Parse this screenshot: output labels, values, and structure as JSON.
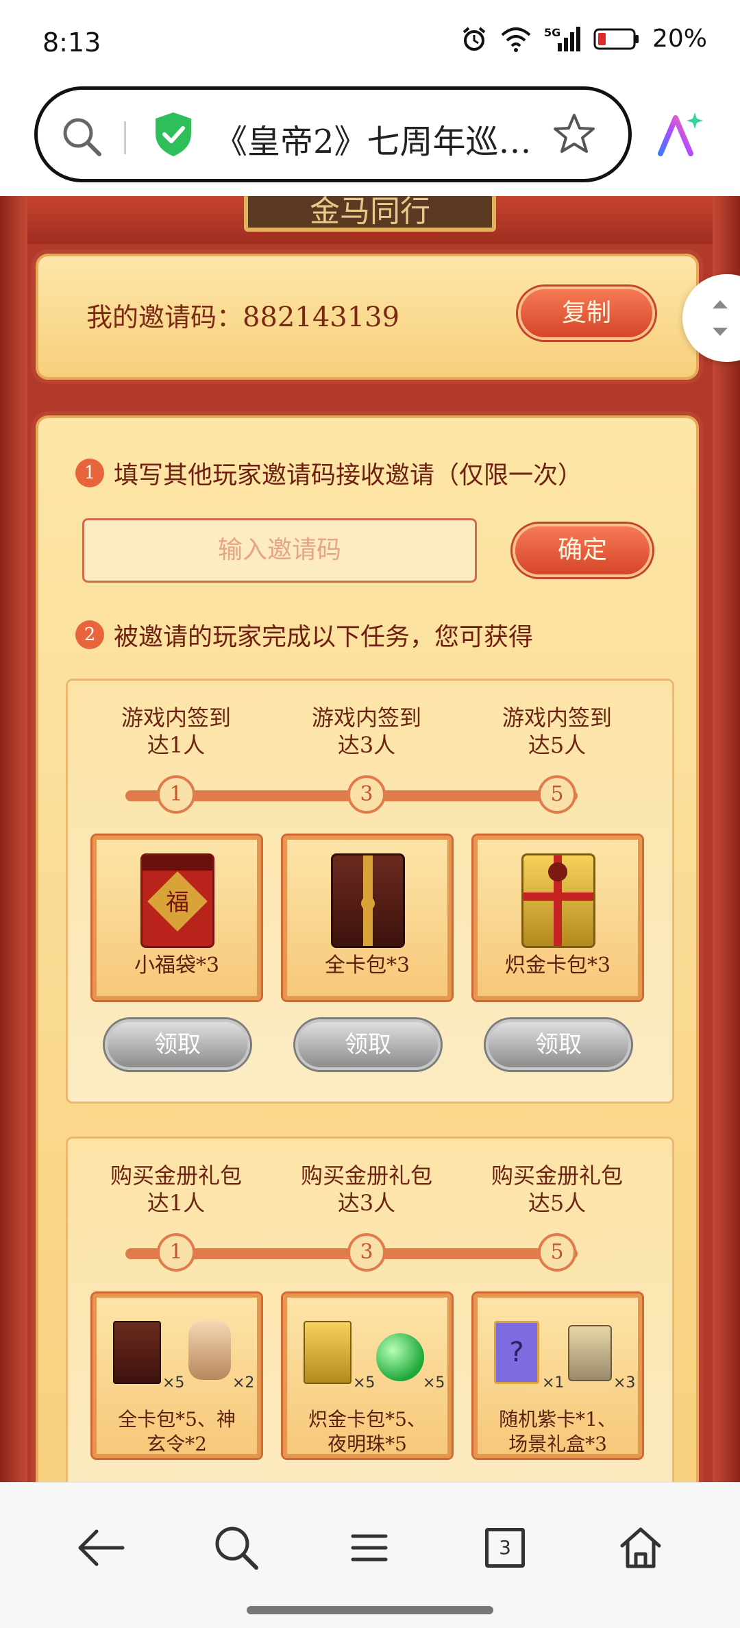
{
  "status": {
    "time": "8:13",
    "battery": "20%",
    "network": "5G"
  },
  "browser": {
    "page_title": "《皇帝2》七周年巡…",
    "tab_count": "3"
  },
  "page": {
    "header_plaque": "金马同行",
    "invite": {
      "label": "我的邀请码：",
      "code": "882143139",
      "copy_label": "复制"
    },
    "step1": {
      "num": "1",
      "text": "填写其他玩家邀请码接收邀请（仅限一次）",
      "input_placeholder": "输入邀请码",
      "confirm_label": "确定"
    },
    "step2": {
      "num": "2",
      "text": "被邀请的玩家完成以下任务，您可获得"
    },
    "task_group_1": {
      "tiers": [
        {
          "label_line1": "游戏内签到",
          "label_line2": "达1人",
          "node": "1",
          "reward": "小福袋*3",
          "claim": "领取"
        },
        {
          "label_line1": "游戏内签到",
          "label_line2": "达3人",
          "node": "3",
          "reward": "全卡包*3",
          "claim": "领取"
        },
        {
          "label_line1": "游戏内签到",
          "label_line2": "达5人",
          "node": "5",
          "reward": "炽金卡包*3",
          "claim": "领取"
        }
      ]
    },
    "task_group_2": {
      "tiers": [
        {
          "label_line1": "购买金册礼包",
          "label_line2": "达1人",
          "node": "1",
          "reward_line1": "全卡包*5、神",
          "reward_line2": "玄令*2",
          "mult_a": "×5",
          "mult_b": "×2"
        },
        {
          "label_line1": "购买金册礼包",
          "label_line2": "达3人",
          "node": "3",
          "reward_line1": "炽金卡包*5、",
          "reward_line2": "夜明珠*5",
          "mult_a": "×5",
          "mult_b": "×5"
        },
        {
          "label_line1": "购买金册礼包",
          "label_line2": "达5人",
          "node": "5",
          "reward_line1": "随机紫卡*1、",
          "reward_line2": "场景礼盒*3",
          "mult_a": "×1",
          "mult_b": "×3"
        }
      ]
    }
  },
  "colors": {
    "accent_red": "#d7452a",
    "panel_gold": "#fde3a6",
    "disabled_gray": "#9a9a9a"
  }
}
